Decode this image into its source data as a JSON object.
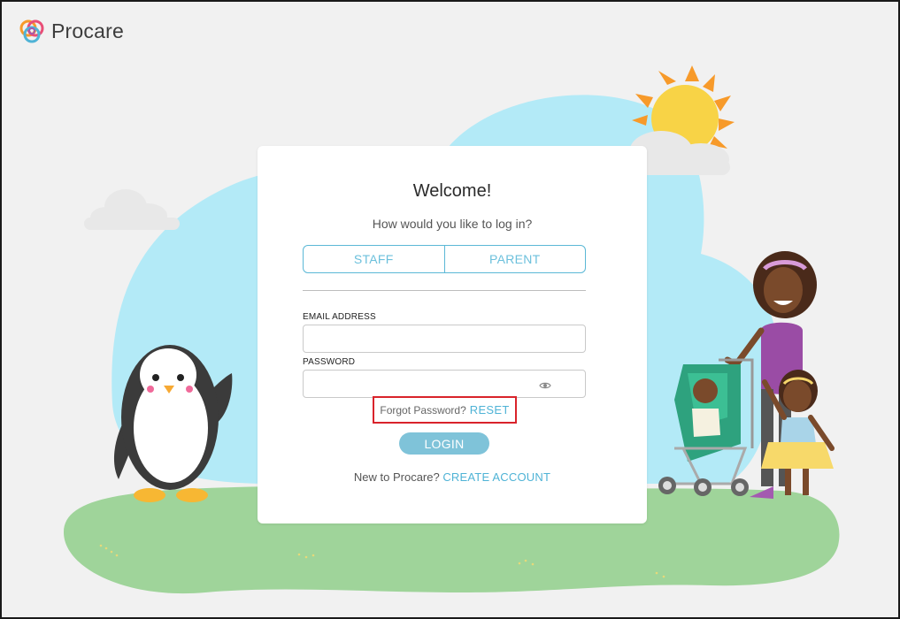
{
  "brand": {
    "name": "Procare"
  },
  "login": {
    "title": "Welcome!",
    "subtitle": "How would you like to log in?",
    "roles": [
      "STAFF",
      "PARENT"
    ],
    "email_label": "EMAIL ADDRESS",
    "email_value": "",
    "password_label": "PASSWORD",
    "password_value": "",
    "forgot_text": "Forgot Password?",
    "reset_label": "RESET",
    "login_label": "LOGIN",
    "new_text": "New to Procare?",
    "create_label": "CREATE ACCOUNT"
  },
  "icons": {
    "password_toggle": "eye-icon"
  },
  "colors": {
    "accent": "#5bb8d6",
    "link": "#4fb3d6",
    "login_button": "#7fc3d9",
    "highlight_border": "#d9232b",
    "sky": "#b3eaf7",
    "grass": "#9fd49a"
  }
}
